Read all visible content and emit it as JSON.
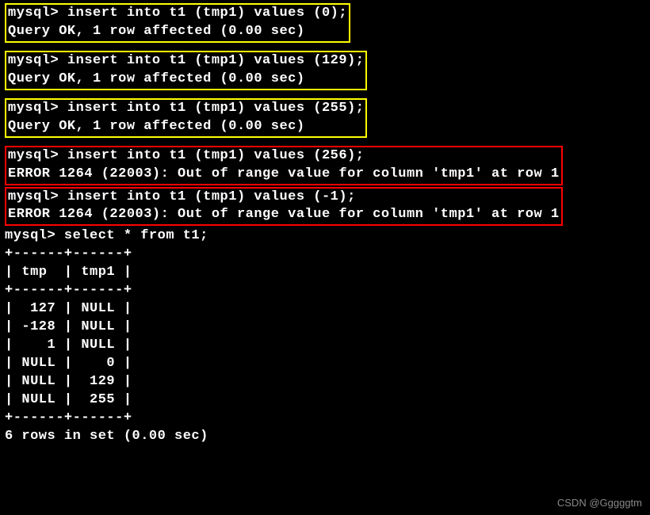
{
  "queries": [
    {
      "box": "yellow",
      "cmd": "mysql> insert into t1 (tmp1) values (0);",
      "result": "Query OK, 1 row affected (0.00 sec)"
    },
    {
      "box": "yellow",
      "cmd": "mysql> insert into t1 (tmp1) values (129);",
      "result": "Query OK, 1 row affected (0.00 sec)"
    },
    {
      "box": "yellow",
      "cmd": "mysql> insert into t1 (tmp1) values (255);",
      "result": "Query OK, 1 row affected (0.00 sec)"
    },
    {
      "box": "red",
      "cmd": "mysql> insert into t1 (tmp1) values (256);",
      "result": "ERROR 1264 (22003): Out of range value for column 'tmp1' at row 1"
    },
    {
      "box": "red",
      "cmd": "mysql> insert into t1 (tmp1) values (-1);",
      "result": "ERROR 1264 (22003): Out of range value for column 'tmp1' at row 1"
    }
  ],
  "select_cmd": "mysql> select * from t1;",
  "table": {
    "sep": "+------+------+",
    "header": "| tmp  | tmp1 |",
    "rows": [
      "|  127 | NULL |",
      "| -128 | NULL |",
      "|    1 | NULL |",
      "| NULL |    0 |",
      "| NULL |  129 |",
      "| NULL |  255 |"
    ],
    "footer": "6 rows in set (0.00 sec)"
  },
  "watermark": "CSDN @Gggggtm"
}
